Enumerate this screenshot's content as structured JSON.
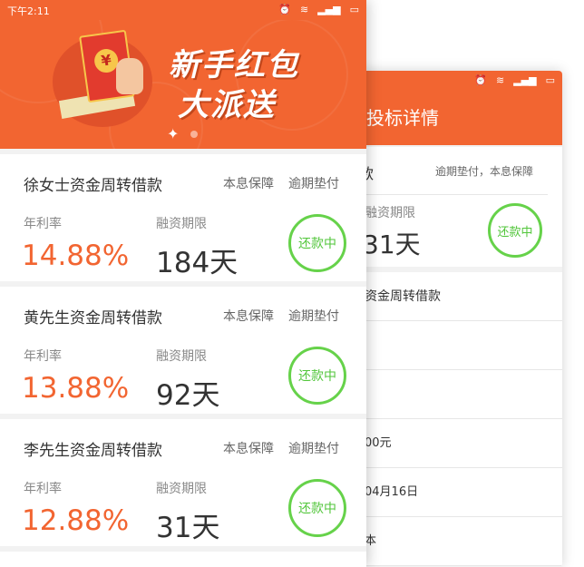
{
  "back_screen": {
    "title": "投标详情",
    "tagline": "逾期垫付，本息保障",
    "title_char": "款",
    "label_term": "融资期限",
    "term_value": "31天",
    "status": "还款中",
    "rows": [
      "资金周转借款",
      "",
      "",
      "00元",
      "04月16日",
      "本"
    ]
  },
  "front_screen": {
    "status_time": "下午2:11",
    "banner": {
      "line1": "新手红包",
      "line2": "大派送"
    },
    "loans": [
      {
        "name": "徐女士资金周转借款",
        "tag1": "本息保障",
        "tag2": "逾期垫付",
        "rate_label": "年利率",
        "rate": "14.88%",
        "term_label": "融资期限",
        "term": "184天",
        "status": "还款中"
      },
      {
        "name": "黄先生资金周转借款",
        "tag1": "本息保障",
        "tag2": "逾期垫付",
        "rate_label": "年利率",
        "rate": "13.88%",
        "term_label": "融资期限",
        "term": "92天",
        "status": "还款中"
      },
      {
        "name": "李先生资金周转借款",
        "tag1": "本息保障",
        "tag2": "逾期垫付",
        "rate_label": "年利率",
        "rate": "12.88%",
        "term_label": "融资期限",
        "term": "31天",
        "status": "还款中"
      }
    ]
  },
  "colors": {
    "accent": "#f26531",
    "status_green": "#66d24a"
  },
  "icons": [
    "alarm-icon",
    "wifi-icon",
    "signal-icon",
    "battery-icon",
    "red-envelope-icon"
  ]
}
